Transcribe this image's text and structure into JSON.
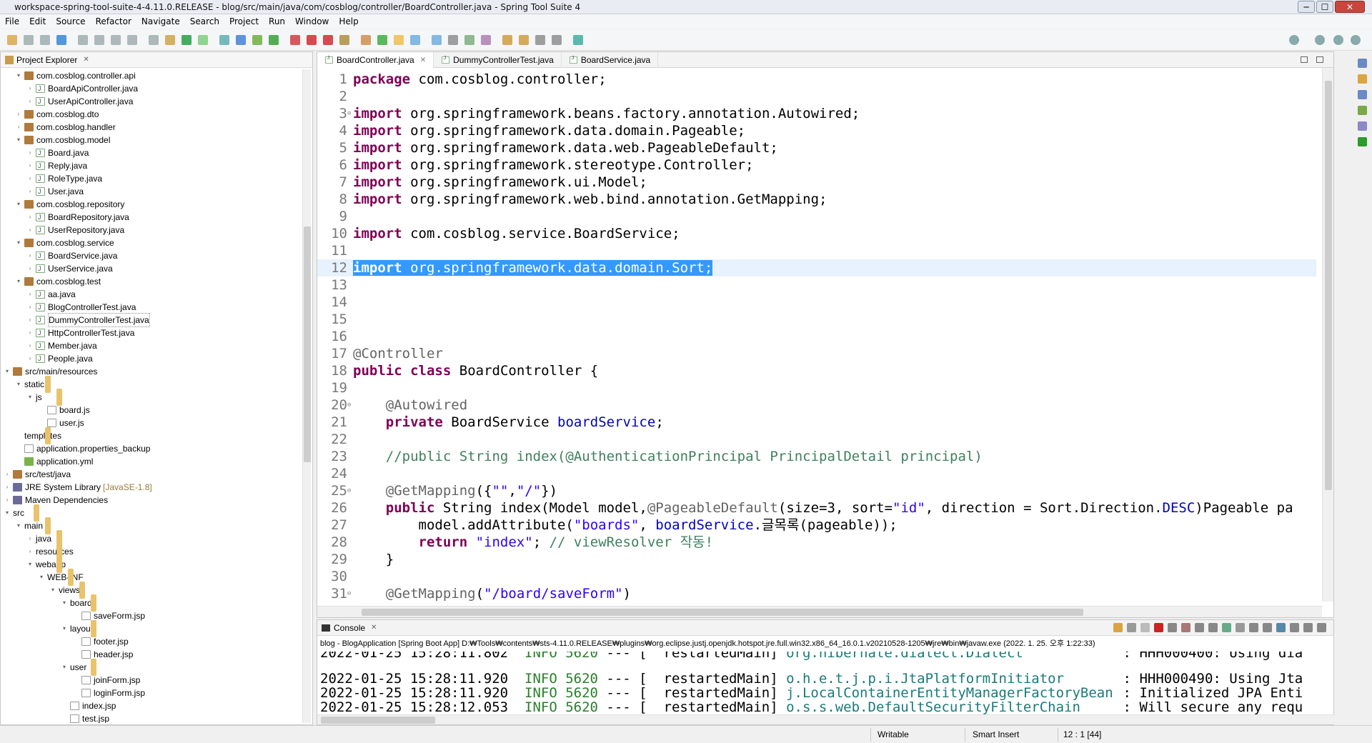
{
  "window": {
    "title": "workspace-spring-tool-suite-4-4.11.0.RELEASE - blog/src/main/java/com/cosblog/controller/BoardController.java - Spring Tool Suite 4",
    "min": "─",
    "max": "☐",
    "close": "✕"
  },
  "menu": [
    "File",
    "Edit",
    "Source",
    "Refactor",
    "Navigate",
    "Search",
    "Project",
    "Run",
    "Window",
    "Help"
  ],
  "explorer": {
    "title": "Project Explorer",
    "close": "✕",
    "items": [
      {
        "label": "com.cosblog.controller.api",
        "indent": 1,
        "icon": "pkg",
        "arrow": "▾"
      },
      {
        "label": "BoardApiController.java",
        "indent": 2,
        "icon": "java",
        "arrow": "›"
      },
      {
        "label": "UserApiController.java",
        "indent": 2,
        "icon": "java",
        "arrow": "›"
      },
      {
        "label": "com.cosblog.dto",
        "indent": 1,
        "icon": "pkg",
        "arrow": "›"
      },
      {
        "label": "com.cosblog.handler",
        "indent": 1,
        "icon": "pkg",
        "arrow": "›"
      },
      {
        "label": "com.cosblog.model",
        "indent": 1,
        "icon": "pkg",
        "arrow": "▾"
      },
      {
        "label": "Board.java",
        "indent": 2,
        "icon": "java",
        "arrow": "›"
      },
      {
        "label": "Reply.java",
        "indent": 2,
        "icon": "java",
        "arrow": "›"
      },
      {
        "label": "RoleType.java",
        "indent": 2,
        "icon": "java",
        "arrow": "›"
      },
      {
        "label": "User.java",
        "indent": 2,
        "icon": "java",
        "arrow": "›"
      },
      {
        "label": "com.cosblog.repository",
        "indent": 1,
        "icon": "pkg",
        "arrow": "▾"
      },
      {
        "label": "BoardRepository.java",
        "indent": 2,
        "icon": "java",
        "arrow": "›"
      },
      {
        "label": "UserRepository.java",
        "indent": 2,
        "icon": "java",
        "arrow": "›"
      },
      {
        "label": "com.cosblog.service",
        "indent": 1,
        "icon": "pkg",
        "arrow": "▾"
      },
      {
        "label": "BoardService.java",
        "indent": 2,
        "icon": "java",
        "arrow": "›"
      },
      {
        "label": "UserService.java",
        "indent": 2,
        "icon": "java",
        "arrow": "›"
      },
      {
        "label": "com.cosblog.test",
        "indent": 1,
        "icon": "pkg",
        "arrow": "▾"
      },
      {
        "label": "aa.java",
        "indent": 2,
        "icon": "java",
        "arrow": "›"
      },
      {
        "label": "BlogControllerTest.java",
        "indent": 2,
        "icon": "java",
        "arrow": "›"
      },
      {
        "label": "DummyControllerTest.java",
        "indent": 2,
        "icon": "java",
        "arrow": "›"
      },
      {
        "label": "HttpControllerTest.java",
        "indent": 2,
        "icon": "java",
        "arrow": "›"
      },
      {
        "label": "Member.java",
        "indent": 2,
        "icon": "java",
        "arrow": "›"
      },
      {
        "label": "People.java",
        "indent": 2,
        "icon": "java",
        "arrow": "›"
      },
      {
        "label": "src/main/resources",
        "indent": 0,
        "icon": "pkg",
        "arrow": "▾"
      },
      {
        "label": "static",
        "indent": 1,
        "icon": "fold",
        "arrow": "▾"
      },
      {
        "label": "js",
        "indent": 2,
        "icon": "fold",
        "arrow": "▾"
      },
      {
        "label": "board.js",
        "indent": 3,
        "icon": "file",
        "arrow": ""
      },
      {
        "label": "user.js",
        "indent": 3,
        "icon": "file",
        "arrow": ""
      },
      {
        "label": "templates",
        "indent": 1,
        "icon": "fold",
        "arrow": ""
      },
      {
        "label": "application.properties_backup",
        "indent": 1,
        "icon": "file",
        "arrow": ""
      },
      {
        "label": "application.yml",
        "indent": 1,
        "icon": "yml",
        "arrow": ""
      },
      {
        "label": "src/test/java",
        "indent": 0,
        "icon": "pkg",
        "arrow": "›"
      },
      {
        "label": "JRE System Library",
        "decor": "[JavaSE-1.8]",
        "indent": 0,
        "icon": "lib",
        "arrow": "›"
      },
      {
        "label": "Maven Dependencies",
        "indent": 0,
        "icon": "lib",
        "arrow": "›"
      },
      {
        "label": "src",
        "indent": 0,
        "icon": "fold",
        "arrow": "▾"
      },
      {
        "label": "main",
        "indent": 1,
        "icon": "fold",
        "arrow": "▾"
      },
      {
        "label": "java",
        "indent": 2,
        "icon": "fold",
        "arrow": "›"
      },
      {
        "label": "resources",
        "indent": 2,
        "icon": "fold",
        "arrow": "›"
      },
      {
        "label": "webapp",
        "indent": 2,
        "icon": "fold",
        "arrow": "▾"
      },
      {
        "label": "WEB-INF",
        "indent": 3,
        "icon": "fold",
        "arrow": "▾"
      },
      {
        "label": "views",
        "indent": 4,
        "icon": "fold",
        "arrow": "▾"
      },
      {
        "label": "board",
        "indent": 5,
        "icon": "fold",
        "arrow": "▾"
      },
      {
        "label": "saveForm.jsp",
        "indent": 6,
        "icon": "file",
        "arrow": ""
      },
      {
        "label": "layout",
        "indent": 5,
        "icon": "fold",
        "arrow": "▾"
      },
      {
        "label": "footer.jsp",
        "indent": 6,
        "icon": "file",
        "arrow": ""
      },
      {
        "label": "header.jsp",
        "indent": 6,
        "icon": "file",
        "arrow": ""
      },
      {
        "label": "user",
        "indent": 5,
        "icon": "fold",
        "arrow": "▾"
      },
      {
        "label": "joinForm.jsp",
        "indent": 6,
        "icon": "file",
        "arrow": ""
      },
      {
        "label": "loginForm.jsp",
        "indent": 6,
        "icon": "file",
        "arrow": ""
      },
      {
        "label": "index.jsp",
        "indent": 5,
        "icon": "file",
        "arrow": ""
      },
      {
        "label": "test.jsp",
        "indent": 5,
        "icon": "file",
        "arrow": ""
      }
    ]
  },
  "editor": {
    "tabs": [
      {
        "label": "BoardController.java",
        "close": "✕",
        "active": true
      },
      {
        "label": "DummyControllerTest.java",
        "close": "",
        "active": false
      },
      {
        "label": "BoardService.java",
        "close": "",
        "active": false
      }
    ],
    "lines": [
      {
        "n": "1",
        "segs": [
          [
            "kw",
            "package"
          ],
          [
            "",
            "com.cosblog.controller;"
          ]
        ]
      },
      {
        "n": "2",
        "segs": []
      },
      {
        "n": "3",
        "fold": "⊖",
        "segs": [
          [
            "kw",
            "import"
          ],
          [
            "",
            "org.springframework.beans.factory.annotation.Autowired;"
          ]
        ]
      },
      {
        "n": "4",
        "segs": [
          [
            "kw",
            "import"
          ],
          [
            "",
            "org.springframework.data.domain.Pageable;"
          ]
        ]
      },
      {
        "n": "5",
        "segs": [
          [
            "kw",
            "import"
          ],
          [
            "",
            "org.springframework.data.web.PageableDefault;"
          ]
        ]
      },
      {
        "n": "6",
        "segs": [
          [
            "kw",
            "import"
          ],
          [
            "",
            "org.springframework.stereotype.Controller;"
          ]
        ]
      },
      {
        "n": "7",
        "segs": [
          [
            "kw",
            "import"
          ],
          [
            "",
            "org.springframework.ui.Model;"
          ]
        ]
      },
      {
        "n": "8",
        "segs": [
          [
            "kw",
            "import"
          ],
          [
            "",
            "org.springframework.web.bind.annotation.GetMapping;"
          ]
        ]
      },
      {
        "n": "9",
        "segs": []
      },
      {
        "n": "10",
        "segs": [
          [
            "kw",
            "import"
          ],
          [
            "",
            "com.cosblog.service.BoardService;"
          ]
        ]
      },
      {
        "n": "11",
        "segs": []
      },
      {
        "n": "12",
        "sel": true,
        "segs": [
          [
            "kw",
            "import"
          ],
          [
            "",
            "org.springframework.data.domain.Sort;"
          ]
        ]
      },
      {
        "n": "13",
        "segs": []
      },
      {
        "n": "14",
        "segs": []
      },
      {
        "n": "15",
        "segs": []
      },
      {
        "n": "16",
        "segs": []
      },
      {
        "n": "17",
        "segs": [
          [
            "ann",
            "@Controller"
          ]
        ]
      },
      {
        "n": "18",
        "segs": [
          [
            "kw",
            "public"
          ],
          [
            "kw",
            "class"
          ],
          [
            "",
            "BoardController {"
          ]
        ]
      },
      {
        "n": "19",
        "segs": []
      },
      {
        "n": "20",
        "fold": "⊖",
        "indent": "    ",
        "segs": [
          [
            "ann",
            "@Autowired"
          ]
        ]
      },
      {
        "n": "21",
        "indent": "    ",
        "segs": [
          [
            "kw",
            "private"
          ],
          [
            "",
            "BoardService"
          ],
          [
            "fld",
            "boardService"
          ],
          [
            "",
            "\b;"
          ]
        ]
      },
      {
        "n": "22",
        "segs": []
      },
      {
        "n": "23",
        "indent": "    ",
        "segs": [
          [
            "cm",
            "//public String index(@AuthenticationPrincipal PrincipalDetail principal)"
          ]
        ]
      },
      {
        "n": "24",
        "segs": []
      },
      {
        "n": "25",
        "fold": "⊖",
        "indent": "    ",
        "segs": [
          [
            "ann",
            "@GetMapping"
          ],
          [
            "",
            "\b({"
          ],
          [
            "str",
            "\b\"\""
          ],
          [
            "",
            "\b,"
          ],
          [
            "str",
            "\b\"/\""
          ],
          [
            "",
            "\b})"
          ]
        ]
      },
      {
        "n": "26",
        "indent": "    ",
        "segs": [
          [
            "kw",
            "public"
          ],
          [
            "",
            "String index(Model model,"
          ],
          [
            "ann",
            "\b@PageableDefault"
          ],
          [
            "",
            "\b(size=3, sort="
          ],
          [
            "str",
            "\b\"id\""
          ],
          [
            "",
            "\b, direction = Sort.Direction."
          ],
          [
            "fld",
            "\bDESC"
          ],
          [
            "",
            "\b)Pageable pa"
          ]
        ]
      },
      {
        "n": "27",
        "indent": "        ",
        "segs": [
          [
            "",
            "model.addAttribute("
          ],
          [
            "str",
            "\b\"boards\""
          ],
          [
            "",
            "\b,"
          ],
          [
            "fld",
            "boardService"
          ],
          [
            "",
            "\b.글목록(pageable));"
          ]
        ]
      },
      {
        "n": "28",
        "indent": "        ",
        "segs": [
          [
            "kw",
            "return"
          ],
          [
            "str",
            "\"index\""
          ],
          [
            "",
            "\b;"
          ],
          [
            "cm",
            "// viewResolver 작동!"
          ]
        ]
      },
      {
        "n": "29",
        "indent": "    ",
        "segs": [
          [
            "",
            "}"
          ]
        ]
      },
      {
        "n": "30",
        "segs": []
      },
      {
        "n": "31",
        "fold": "⊖",
        "indent": "    ",
        "segs": [
          [
            "ann",
            "@GetMapping"
          ],
          [
            "",
            "\b("
          ],
          [
            "str",
            "\b\"/board/saveForm\""
          ],
          [
            "",
            "\b)"
          ]
        ]
      }
    ]
  },
  "console": {
    "title": "Console",
    "close": "✕",
    "launch": "blog - BlogApplication [Spring Boot App] D:₩Tools₩contents₩sts-4.11.0.RELEASE₩plugins₩org.eclipse.justj.openjdk.hotspot.jre.full.win32.x86_64_16.0.1.v20210528-1205₩jre₩bin₩javaw.exe  (2022. 1. 25. 오후 1:22:33)",
    "lines": [
      {
        "ts": "2022-01-25 15:28:11.802",
        "lvl": "INFO",
        "pid": "5620",
        "thread": "restartedMain",
        "cls": "org.hibernate.dialect.Dialect",
        "msg": "HHH000400: Using dia"
      },
      {
        "ts": "2022-01-25 15:28:11.920",
        "lvl": "INFO",
        "pid": "5620",
        "thread": "restartedMain",
        "cls": "o.h.e.t.j.p.i.JtaPlatformInitiator",
        "msg": "HHH000490: Using Jta"
      },
      {
        "ts": "2022-01-25 15:28:11.920",
        "lvl": "INFO",
        "pid": "5620",
        "thread": "restartedMain",
        "cls": "j.LocalContainerEntityManagerFactoryBean",
        "msg": "Initialized JPA Enti"
      },
      {
        "ts": "2022-01-25 15:28:12.053",
        "lvl": "INFO",
        "pid": "5620",
        "thread": "restartedMain",
        "cls": "o.s.s.web.DefaultSecurityFilterChain",
        "msg": "Will secure any requ"
      }
    ]
  },
  "status": {
    "writable": "Writable",
    "insert": "Smart Insert",
    "position": "12 : 1 [44]"
  }
}
